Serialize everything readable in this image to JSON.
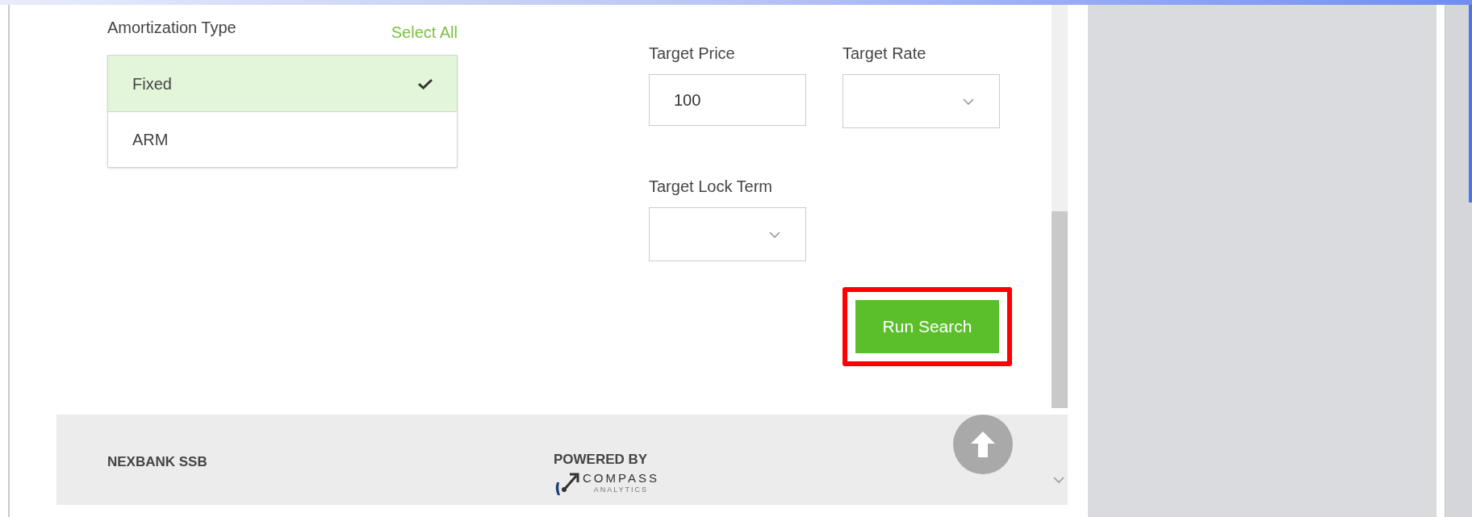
{
  "amortization": {
    "label": "Amortization Type",
    "select_all": "Select All",
    "options": [
      {
        "label": "Fixed",
        "selected": true
      },
      {
        "label": "ARM",
        "selected": false
      }
    ]
  },
  "fields": [
    {
      "label": "Target Price",
      "kind": "input",
      "value": "100"
    },
    {
      "label": "Target Rate",
      "kind": "select"
    },
    {
      "label": "Target Lock Term",
      "kind": "select"
    }
  ],
  "run_button": {
    "label": "Run Search",
    "highlighted": true
  },
  "footer": {
    "bank": "NEXBANK SSB",
    "powered_by": "POWERED BY",
    "logo_name": "COMPASS",
    "logo_tagline": "ANALYTICS"
  }
}
